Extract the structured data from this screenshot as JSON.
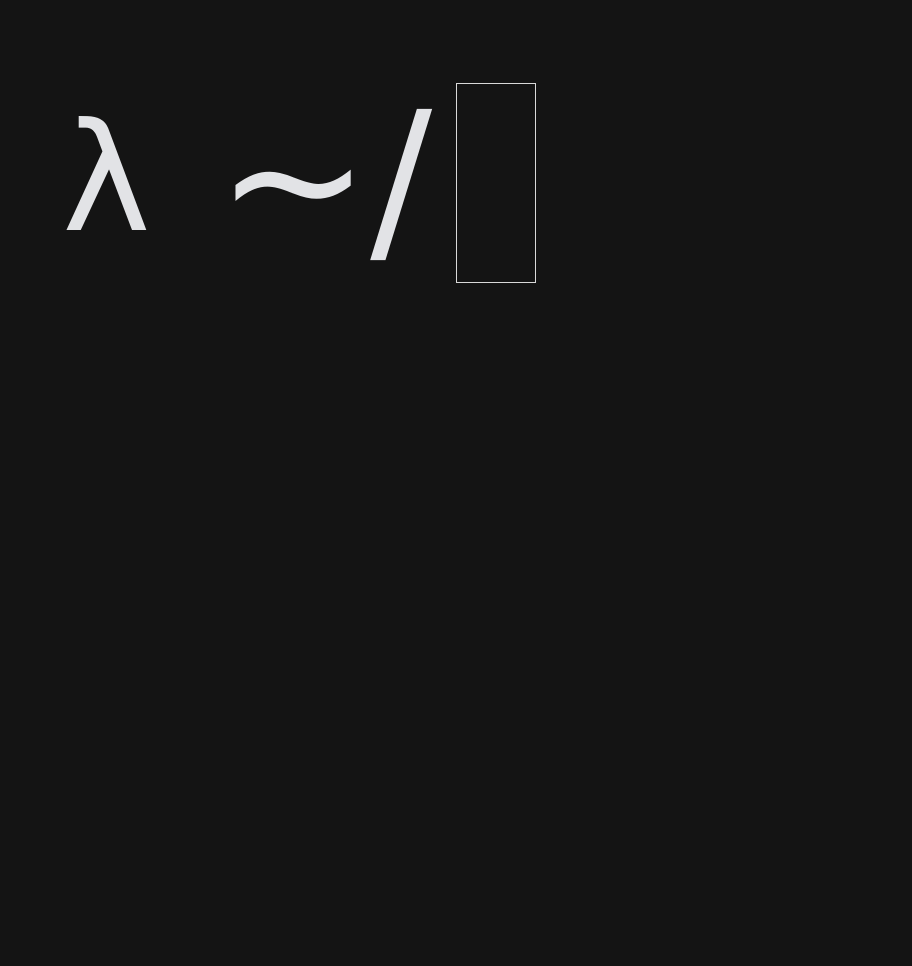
{
  "terminal": {
    "prompt_symbol": "λ",
    "cwd": "~/",
    "input_text": "",
    "cursor_style": "block-outline"
  },
  "colors": {
    "background": "#141414",
    "foreground": "#e2e3e6",
    "cursor_border": "#d9d9d9"
  }
}
